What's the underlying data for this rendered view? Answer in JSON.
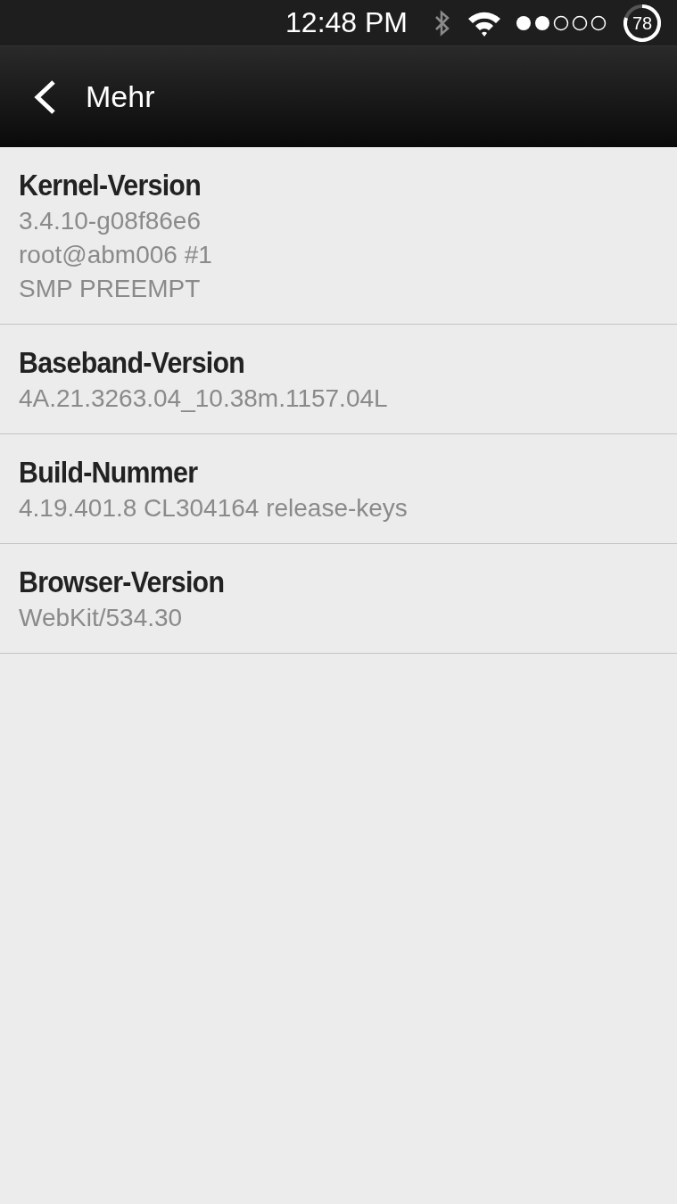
{
  "status_bar": {
    "time": "12:48 PM",
    "battery": "78"
  },
  "action_bar": {
    "title": "Mehr"
  },
  "items": [
    {
      "title": "Kernel-Version",
      "value": "3.4.10-g08f86e6\nroot@abm006 #1\nSMP PREEMPT"
    },
    {
      "title": "Baseband-Version",
      "value": "4A.21.3263.04_10.38m.1157.04L"
    },
    {
      "title": "Build-Nummer",
      "value": "4.19.401.8 CL304164 release-keys"
    },
    {
      "title": "Browser-Version",
      "value": "WebKit/534.30"
    }
  ]
}
